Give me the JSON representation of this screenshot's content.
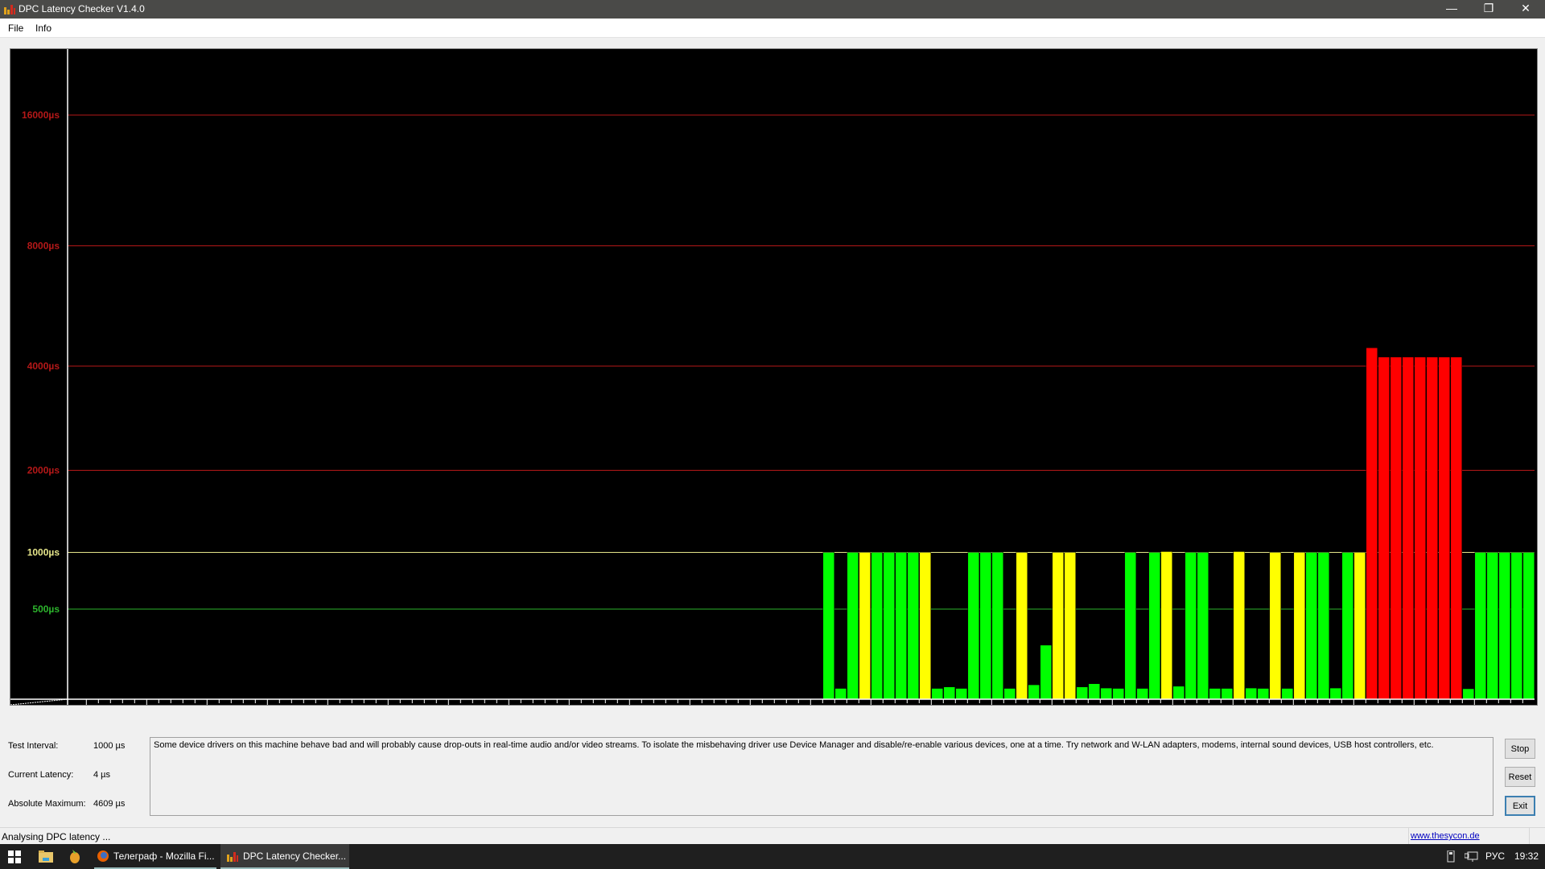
{
  "window": {
    "title": "DPC Latency Checker V1.4.0",
    "minimize_glyph": "—",
    "restore_glyph": "❐",
    "close_glyph": "✕"
  },
  "menu": {
    "file": "File",
    "info": "Info"
  },
  "chart_data": {
    "type": "bar",
    "title": "",
    "xlabel": "s",
    "ylabel": "µs",
    "x_range": [
      -120,
      0
    ],
    "x_ticks": [
      -120,
      -115,
      -110,
      -105,
      -100,
      -95,
      -90,
      -85,
      -80,
      -75,
      -70,
      -65,
      -60,
      -55,
      -50,
      -45,
      -40,
      -35,
      -30,
      -25,
      -20,
      -15,
      -10,
      -5
    ],
    "y_gridlines": [
      {
        "value": 500,
        "label": "500µs",
        "color": "#2db52d"
      },
      {
        "value": 1000,
        "label": "1000µs",
        "color": "#e6e68a"
      },
      {
        "value": 2000,
        "label": "2000µs",
        "color": "#b51818"
      },
      {
        "value": 4000,
        "label": "4000µs",
        "color": "#b51818"
      },
      {
        "value": 8000,
        "label": "8000µs",
        "color": "#b51818"
      },
      {
        "value": 16000,
        "label": "16000µs",
        "color": "#b51818"
      }
    ],
    "colors": {
      "green": "#00ff00",
      "yellow": "#ffff00",
      "red": "#ff0000"
    },
    "bars": [
      {
        "t": -59,
        "value": 1000,
        "color": "green"
      },
      {
        "t": -58,
        "value": 60,
        "color": "green"
      },
      {
        "t": -57,
        "value": 1000,
        "color": "green"
      },
      {
        "t": -56,
        "value": 1000,
        "color": "yellow"
      },
      {
        "t": -55,
        "value": 1000,
        "color": "green"
      },
      {
        "t": -54,
        "value": 1000,
        "color": "green"
      },
      {
        "t": -53,
        "value": 1000,
        "color": "green"
      },
      {
        "t": -52,
        "value": 1000,
        "color": "green"
      },
      {
        "t": -51,
        "value": 1000,
        "color": "yellow"
      },
      {
        "t": -50,
        "value": 60,
        "color": "green"
      },
      {
        "t": -49,
        "value": 68,
        "color": "green"
      },
      {
        "t": -48,
        "value": 60,
        "color": "green"
      },
      {
        "t": -47,
        "value": 1000,
        "color": "green"
      },
      {
        "t": -46,
        "value": 1000,
        "color": "green"
      },
      {
        "t": -45,
        "value": 1000,
        "color": "green"
      },
      {
        "t": -44,
        "value": 60,
        "color": "green"
      },
      {
        "t": -43,
        "value": 1000,
        "color": "yellow"
      },
      {
        "t": -42,
        "value": 80,
        "color": "green"
      },
      {
        "t": -41,
        "value": 300,
        "color": "green"
      },
      {
        "t": -40,
        "value": 1000,
        "color": "yellow"
      },
      {
        "t": -39,
        "value": 1000,
        "color": "yellow"
      },
      {
        "t": -38,
        "value": 68,
        "color": "green"
      },
      {
        "t": -37,
        "value": 86,
        "color": "green"
      },
      {
        "t": -36,
        "value": 62,
        "color": "green"
      },
      {
        "t": -35,
        "value": 60,
        "color": "green"
      },
      {
        "t": -34,
        "value": 1000,
        "color": "green"
      },
      {
        "t": -33,
        "value": 60,
        "color": "green"
      },
      {
        "t": -32,
        "value": 1000,
        "color": "green"
      },
      {
        "t": -31,
        "value": 1010,
        "color": "yellow"
      },
      {
        "t": -30,
        "value": 72,
        "color": "green"
      },
      {
        "t": -29,
        "value": 1000,
        "color": "green"
      },
      {
        "t": -28,
        "value": 1000,
        "color": "green"
      },
      {
        "t": -27,
        "value": 60,
        "color": "green"
      },
      {
        "t": -26,
        "value": 60,
        "color": "green"
      },
      {
        "t": -25,
        "value": 1010,
        "color": "yellow"
      },
      {
        "t": -24,
        "value": 62,
        "color": "green"
      },
      {
        "t": -23,
        "value": 60,
        "color": "green"
      },
      {
        "t": -22,
        "value": 1000,
        "color": "yellow"
      },
      {
        "t": -21,
        "value": 60,
        "color": "green"
      },
      {
        "t": -20,
        "value": 1000,
        "color": "yellow"
      },
      {
        "t": -19,
        "value": 1000,
        "color": "green"
      },
      {
        "t": -18,
        "value": 1000,
        "color": "green"
      },
      {
        "t": -17,
        "value": 62,
        "color": "green"
      },
      {
        "t": -16,
        "value": 1000,
        "color": "green"
      },
      {
        "t": -15,
        "value": 1000,
        "color": "yellow"
      },
      {
        "t": -14,
        "value": 4609,
        "color": "red"
      },
      {
        "t": -13,
        "value": 4300,
        "color": "red"
      },
      {
        "t": -12,
        "value": 4300,
        "color": "red"
      },
      {
        "t": -11,
        "value": 4300,
        "color": "red"
      },
      {
        "t": -10,
        "value": 4300,
        "color": "red"
      },
      {
        "t": -9,
        "value": 4300,
        "color": "red"
      },
      {
        "t": -8,
        "value": 4300,
        "color": "red"
      },
      {
        "t": -7,
        "value": 4300,
        "color": "red"
      },
      {
        "t": -6,
        "value": 58,
        "color": "green"
      },
      {
        "t": -5,
        "value": 1000,
        "color": "green"
      },
      {
        "t": -4,
        "value": 1000,
        "color": "green"
      },
      {
        "t": -3,
        "value": 1000,
        "color": "green"
      },
      {
        "t": -2,
        "value": 1000,
        "color": "green"
      },
      {
        "t": -1,
        "value": 1000,
        "color": "green"
      }
    ],
    "corner_labels": {
      "y_unit": "µs",
      "x_unit": "s"
    }
  },
  "info": {
    "test_interval_label": "Test Interval:",
    "test_interval_value": "1000 µs",
    "current_latency_label": "Current Latency:",
    "current_latency_value": "4 µs",
    "absolute_max_label": "Absolute Maximum:",
    "absolute_max_value": "4609 µs"
  },
  "message": "Some device drivers on this machine behave bad and will probably cause drop-outs in real-time audio and/or video streams. To isolate the misbehaving driver use Device Manager and disable/re-enable various devices, one at a time. Try network and W-LAN adapters, modems, internal sound devices, USB host controllers, etc.",
  "buttons": {
    "stop": "Stop",
    "reset": "Reset",
    "exit": "Exit"
  },
  "statusbar": {
    "text": "Analysing DPC latency ...",
    "link": "www.thesycon.de"
  },
  "taskbar": {
    "tasks": [
      {
        "label": "Телеграф - Mozilla Fi..."
      },
      {
        "label": "DPC Latency Checker..."
      }
    ],
    "language": "РУС",
    "time": "19:32"
  }
}
